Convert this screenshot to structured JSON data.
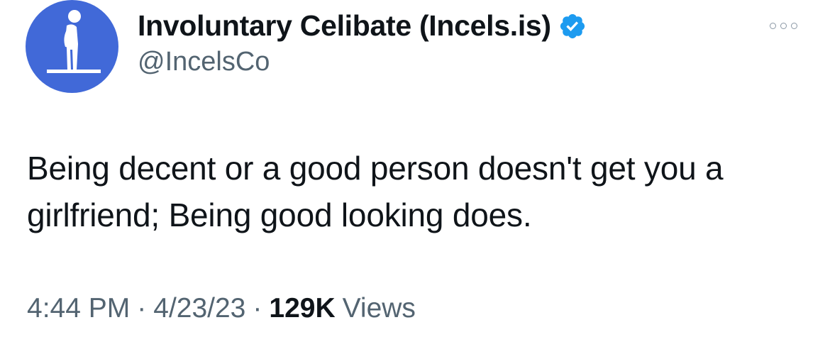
{
  "tweet": {
    "author": {
      "display_name": "Involuntary Celibate (Incels.is)",
      "handle": "@IncelsCo",
      "verified": true,
      "avatar_icon": "man-standing-icon",
      "avatar_bg_color": "#4169d8",
      "verified_color": "#1d9bf0"
    },
    "text": "Being decent or a good person doesn't get you a\ngirlfriend; Being good looking does.",
    "time": "4:44 PM",
    "separator": "·",
    "date": "4/23/23",
    "views_count": "129K",
    "views_label": "Views",
    "more_icon": "more-options-icon"
  }
}
